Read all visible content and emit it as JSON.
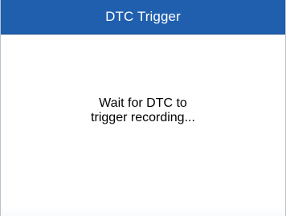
{
  "window": {
    "title": "DTC Trigger"
  },
  "main": {
    "message_line_1": "Wait for DTC to",
    "message_line_2": "trigger recording..."
  },
  "colors": {
    "title_bar": "#1f5fae",
    "title_text": "#ffffff",
    "background": "#ffffff",
    "text": "#000000"
  }
}
